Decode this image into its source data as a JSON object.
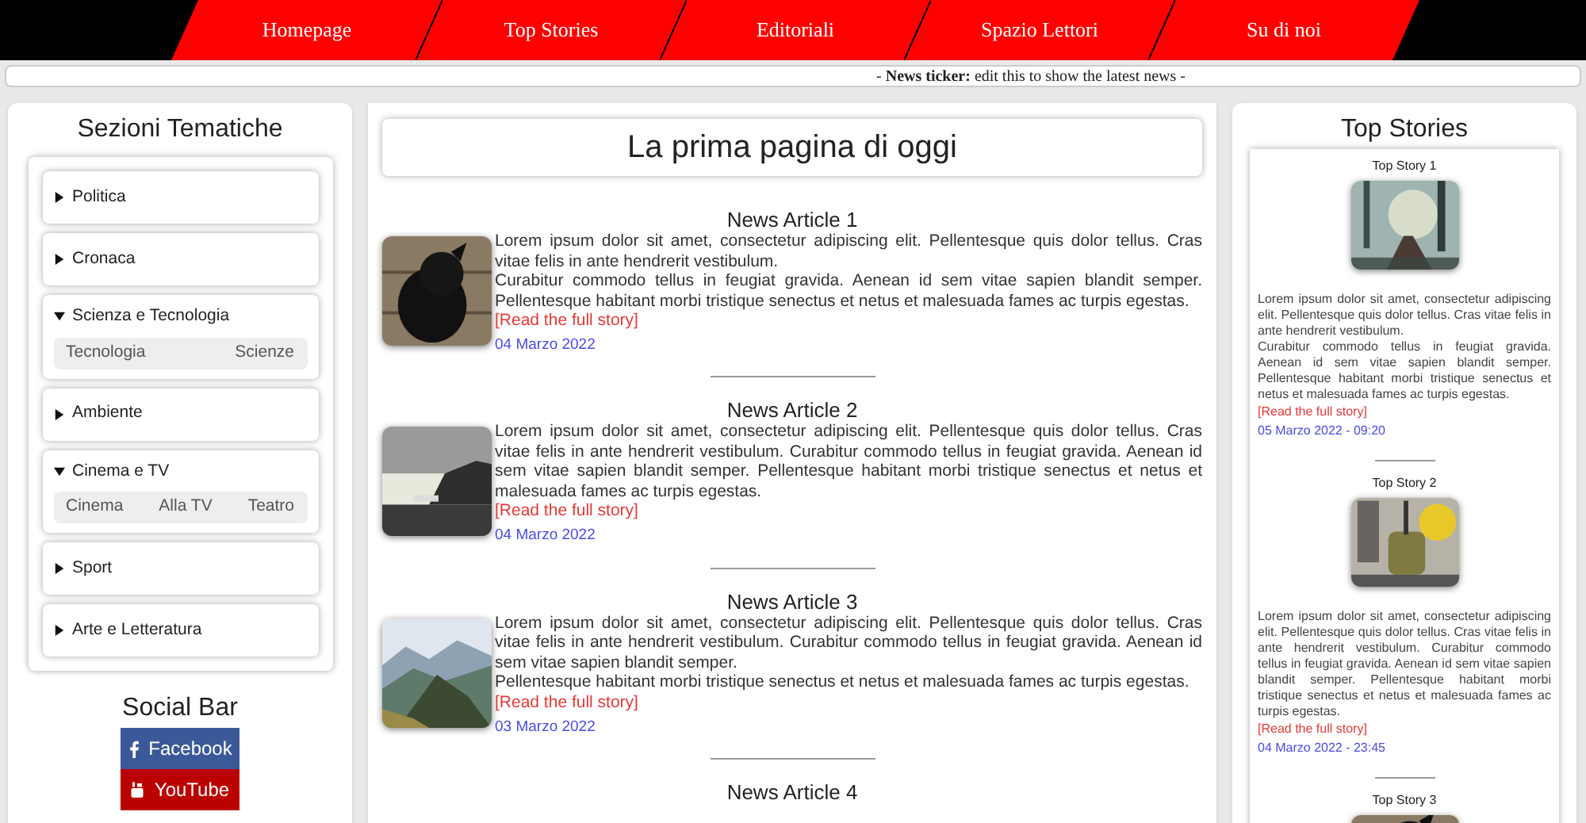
{
  "nav": [
    {
      "label": "Homepage"
    },
    {
      "label": "Top Stories"
    },
    {
      "label": "Editoriali"
    },
    {
      "label": "Spazio Lettori"
    },
    {
      "label": "Su di noi"
    }
  ],
  "ticker": "- **News ticker:** edit this to show the latest news -",
  "sidebar": {
    "title": "Sezioni Tematiche",
    "sections": [
      {
        "label": "Politica",
        "expanded": false
      },
      {
        "label": "Cronaca",
        "expanded": false
      },
      {
        "label": "Scienza e Tecnologia",
        "expanded": true,
        "children": [
          "Tecnologia",
          "Scienze"
        ]
      },
      {
        "label": "Ambiente",
        "expanded": false
      },
      {
        "label": "Cinema e TV",
        "expanded": true,
        "children": [
          "Cinema",
          "Alla TV",
          "Teatro"
        ]
      },
      {
        "label": "Sport",
        "expanded": false
      },
      {
        "label": "Arte e Letteratura",
        "expanded": false
      }
    ]
  },
  "social": {
    "title": "Social Bar",
    "links": [
      {
        "label": "Facebook",
        "kind": "facebook",
        "color": "#3b5998"
      },
      {
        "label": "YouTube",
        "kind": "youtube",
        "color": "#bb0000"
      }
    ]
  },
  "main": {
    "title": "La prima pagina di oggi",
    "articles": [
      {
        "title": "News Article 1",
        "paragraphs": [
          "Lorem ipsum dolor sit amet, consectetur adipiscing elit. Pellentesque quis dolor tellus. Cras vitae felis in ante hendrerit vestibulum.",
          "Curabitur commodo tellus in feugiat gravida. Aenean id sem vitae sapien blandit semper. Pellentesque habitant morbi tristique senectus et netus et malesuada fames ac turpis egestas."
        ],
        "link": "[Read the full story]",
        "date": "04 Marzo 2022"
      },
      {
        "title": "News Article 2",
        "paragraphs": [
          "Lorem ipsum dolor sit amet, consectetur adipiscing elit. Pellentesque quis dolor tellus. Cras vitae felis in ante hendrerit vestibulum. Curabitur commodo tellus in feugiat gravida. Aenean id sem vitae sapien blandit semper. Pellentesque habitant morbi tristique senectus et netus et malesuada fames ac turpis egestas."
        ],
        "link": "[Read the full story]",
        "date": "04 Marzo 2022"
      },
      {
        "title": "News Article 3",
        "paragraphs": [
          "Lorem ipsum dolor sit amet, consectetur adipiscing elit. Pellentesque quis dolor tellus. Cras vitae felis in ante hendrerit vestibulum. Curabitur commodo tellus in feugiat gravida. Aenean id sem vitae sapien blandit semper.",
          "Pellentesque habitant morbi tristique senectus et netus et malesuada fames ac turpis egestas."
        ],
        "link": "[Read the full story]",
        "date": "03 Marzo 2022"
      },
      {
        "title": "News Article 4"
      }
    ]
  },
  "top_stories": {
    "title": "Top Stories",
    "stories": [
      {
        "title": "Top Story 1",
        "paragraphs": [
          "Lorem ipsum dolor sit amet, consectetur adipiscing elit. Pellentesque quis dolor tellus. Cras vitae felis in ante hendrerit vestibulum.",
          "Curabitur commodo tellus in feugiat gravida. Aenean id sem vitae sapien blandit semper. Pellentesque habitant morbi tristique senectus et netus et malesuada fames ac turpis egestas."
        ],
        "link": "[Read the full story]",
        "date": "05 Marzo 2022 - 09:20"
      },
      {
        "title": "Top Story 2",
        "paragraphs": [
          "Lorem ipsum dolor sit amet, consectetur adipiscing elit. Pellentesque quis dolor tellus. Cras vitae felis in ante hendrerit vestibulum. Curabitur commodo tellus in feugiat gravida. Aenean id sem vitae sapien blandit semper. Pellentesque habitant morbi tristique senectus et netus et malesuada fames ac turpis egestas."
        ],
        "link": "[Read the full story]",
        "date": "04 Marzo 2022 - 23:45"
      },
      {
        "title": "Top Story 3"
      }
    ]
  }
}
